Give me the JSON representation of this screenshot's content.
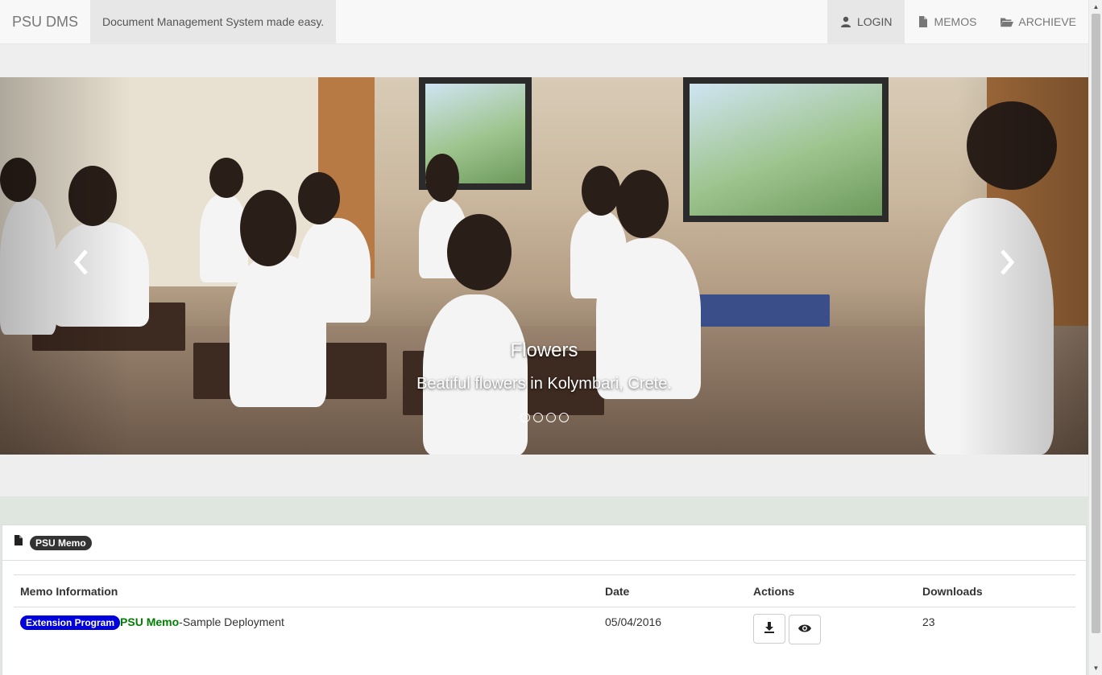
{
  "navbar": {
    "brand": "PSU DMS",
    "tagline": "Document Management System made easy.",
    "items": [
      {
        "label": "LOGIN",
        "icon": "user-icon",
        "active": true
      },
      {
        "label": "MEMOS",
        "icon": "file-icon",
        "active": false
      },
      {
        "label": "ARCHIEVE",
        "icon": "folder-open-icon",
        "active": false
      }
    ]
  },
  "carousel": {
    "title": "Flowers",
    "text": "Beatiful flowers in Kolymbari, Crete.",
    "prev_icon": "chevron-left-icon",
    "next_icon": "chevron-right-icon",
    "slide_count": 4,
    "active_index": 0
  },
  "panel": {
    "heading_icon": "file-icon",
    "heading_badge": "PSU Memo",
    "table": {
      "headers": [
        "Memo Information",
        "Date",
        "Actions",
        "Downloads"
      ],
      "rows": [
        {
          "category": "Extension Program",
          "memo_name": "PSU Memo",
          "memo_suffix": "-Sample Deployment",
          "date": "05/04/2016",
          "download_icon": "download-icon",
          "view_icon": "eye-icon",
          "downloads": "23"
        }
      ]
    }
  },
  "colors": {
    "category_badge": "#0000dd",
    "memo_link": "#008000",
    "heading_badge": "#333333"
  }
}
